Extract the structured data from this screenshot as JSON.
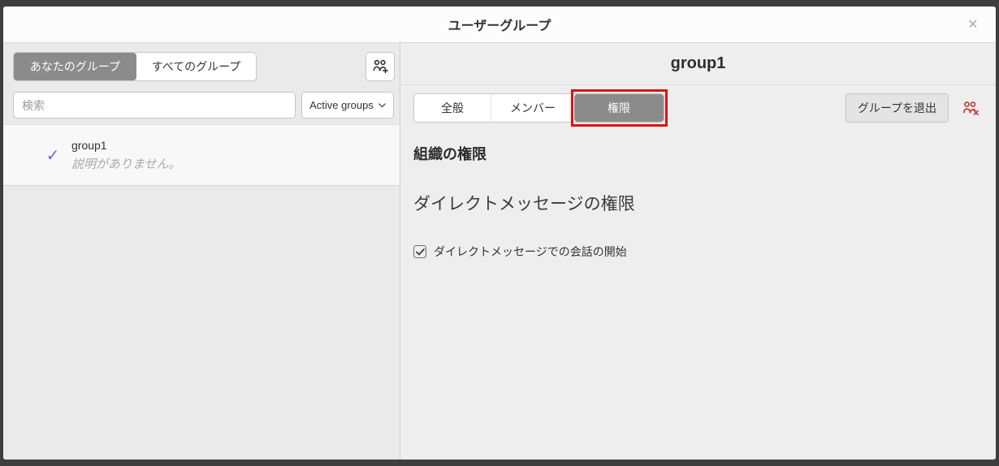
{
  "modal": {
    "title": "ユーザーグループ",
    "close_icon": "×"
  },
  "left_panel": {
    "tabs": [
      {
        "label": "あなたのグループ",
        "selected": true
      },
      {
        "label": "すべてのグループ",
        "selected": false
      }
    ],
    "create_group_icon": "user-group-plus",
    "search": {
      "placeholder": "検索",
      "value": ""
    },
    "filter_dropdown": {
      "value": "Active groups"
    },
    "groups": [
      {
        "name": "group1",
        "description": "説明がありません。",
        "selected": true,
        "check_glyph": "✓"
      }
    ]
  },
  "right_panel": {
    "header": "group1",
    "tabs": [
      {
        "label": "全般",
        "selected": false
      },
      {
        "label": "メンバー",
        "selected": false
      },
      {
        "label": "権限",
        "selected": true,
        "annotated": true
      }
    ],
    "leave_button_label": "グループを退出",
    "leave_icon": "user-group-x",
    "content": {
      "org_permissions_heading": "組織の権限",
      "dm_permissions_heading": "ダイレクトメッセージの権限",
      "dm_checkbox": {
        "label": "ダイレクトメッセージでの会話の開始",
        "checked": true
      }
    }
  },
  "colors": {
    "selected_tab_bg": "#8b8b8b",
    "check_accent": "#6d68e8",
    "annotation_red": "#e01212",
    "leave_icon_red": "#bf4440",
    "panel_bg": "#ebebeb",
    "overlay_bg": "#3e3e3e"
  }
}
